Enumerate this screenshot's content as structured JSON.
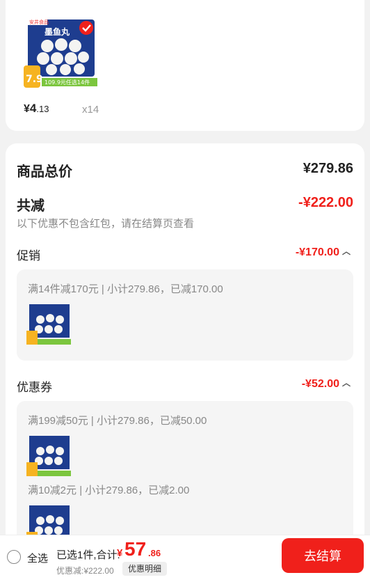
{
  "product": {
    "brand": "安井食品",
    "package_title": "墨鱼丸",
    "badge_price": "7.9",
    "banner_text": "109.9元任选14件",
    "price_yen": "¥",
    "price_int": "4",
    "price_dec": ".13",
    "qty": "x14",
    "checked": true
  },
  "summary": {
    "total_label": "商品总价",
    "total_value": "¥279.86",
    "reduce_label": "共减",
    "reduce_value": "-¥222.00",
    "note": "以下优惠不包含红包，请在结算页查看",
    "promo": {
      "label": "促销",
      "amount": "-¥170.00",
      "detail": "满14件减170元 | 小计279.86，已减170.00"
    },
    "coupon": {
      "label": "优惠券",
      "amount": "-¥52.00",
      "detail1": "满199减50元 | 小计279.86，已减50.00",
      "detail2": "满10减2元 | 小计279.86，已减2.00"
    }
  },
  "bottom": {
    "select_all": "全选",
    "selected": "已选1件,合计:",
    "total_yen": "¥",
    "total_int": "57",
    "total_dec": ".86",
    "discount": "优惠减:¥222.00",
    "detail_tag": "优惠明细",
    "checkout": "去结算"
  },
  "colors": {
    "accent": "#f0201b",
    "product_blue": "#1e3d8f"
  }
}
